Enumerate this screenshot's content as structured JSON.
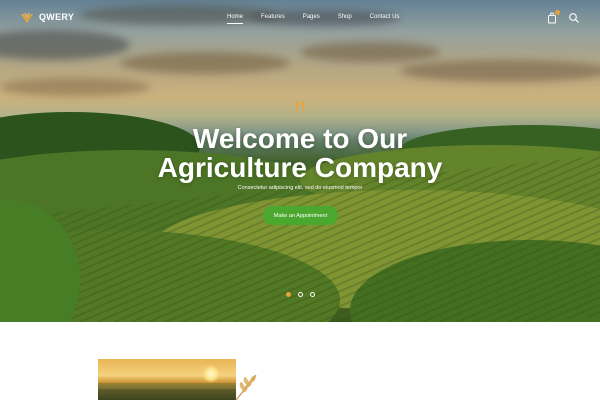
{
  "brand": {
    "name": "QWERY",
    "accent": "#e8a33b"
  },
  "nav": {
    "items": [
      "Home",
      "Features",
      "Pages",
      "Shop",
      "Contact Us"
    ],
    "active": "Home"
  },
  "hero": {
    "title_line1": "Welcome to Our",
    "title_line2": "Agriculture Company",
    "subtitle": "Consectetur adipiscing elit, sed do eiusmod tempor",
    "cta_label": "Make an Appointment",
    "cta_color": "#4ba82e",
    "slides": 3,
    "active_slide": 1
  },
  "icons": {
    "cart": "shopping-bag-icon",
    "search": "search-icon",
    "logo": "wheat-logo-icon"
  }
}
